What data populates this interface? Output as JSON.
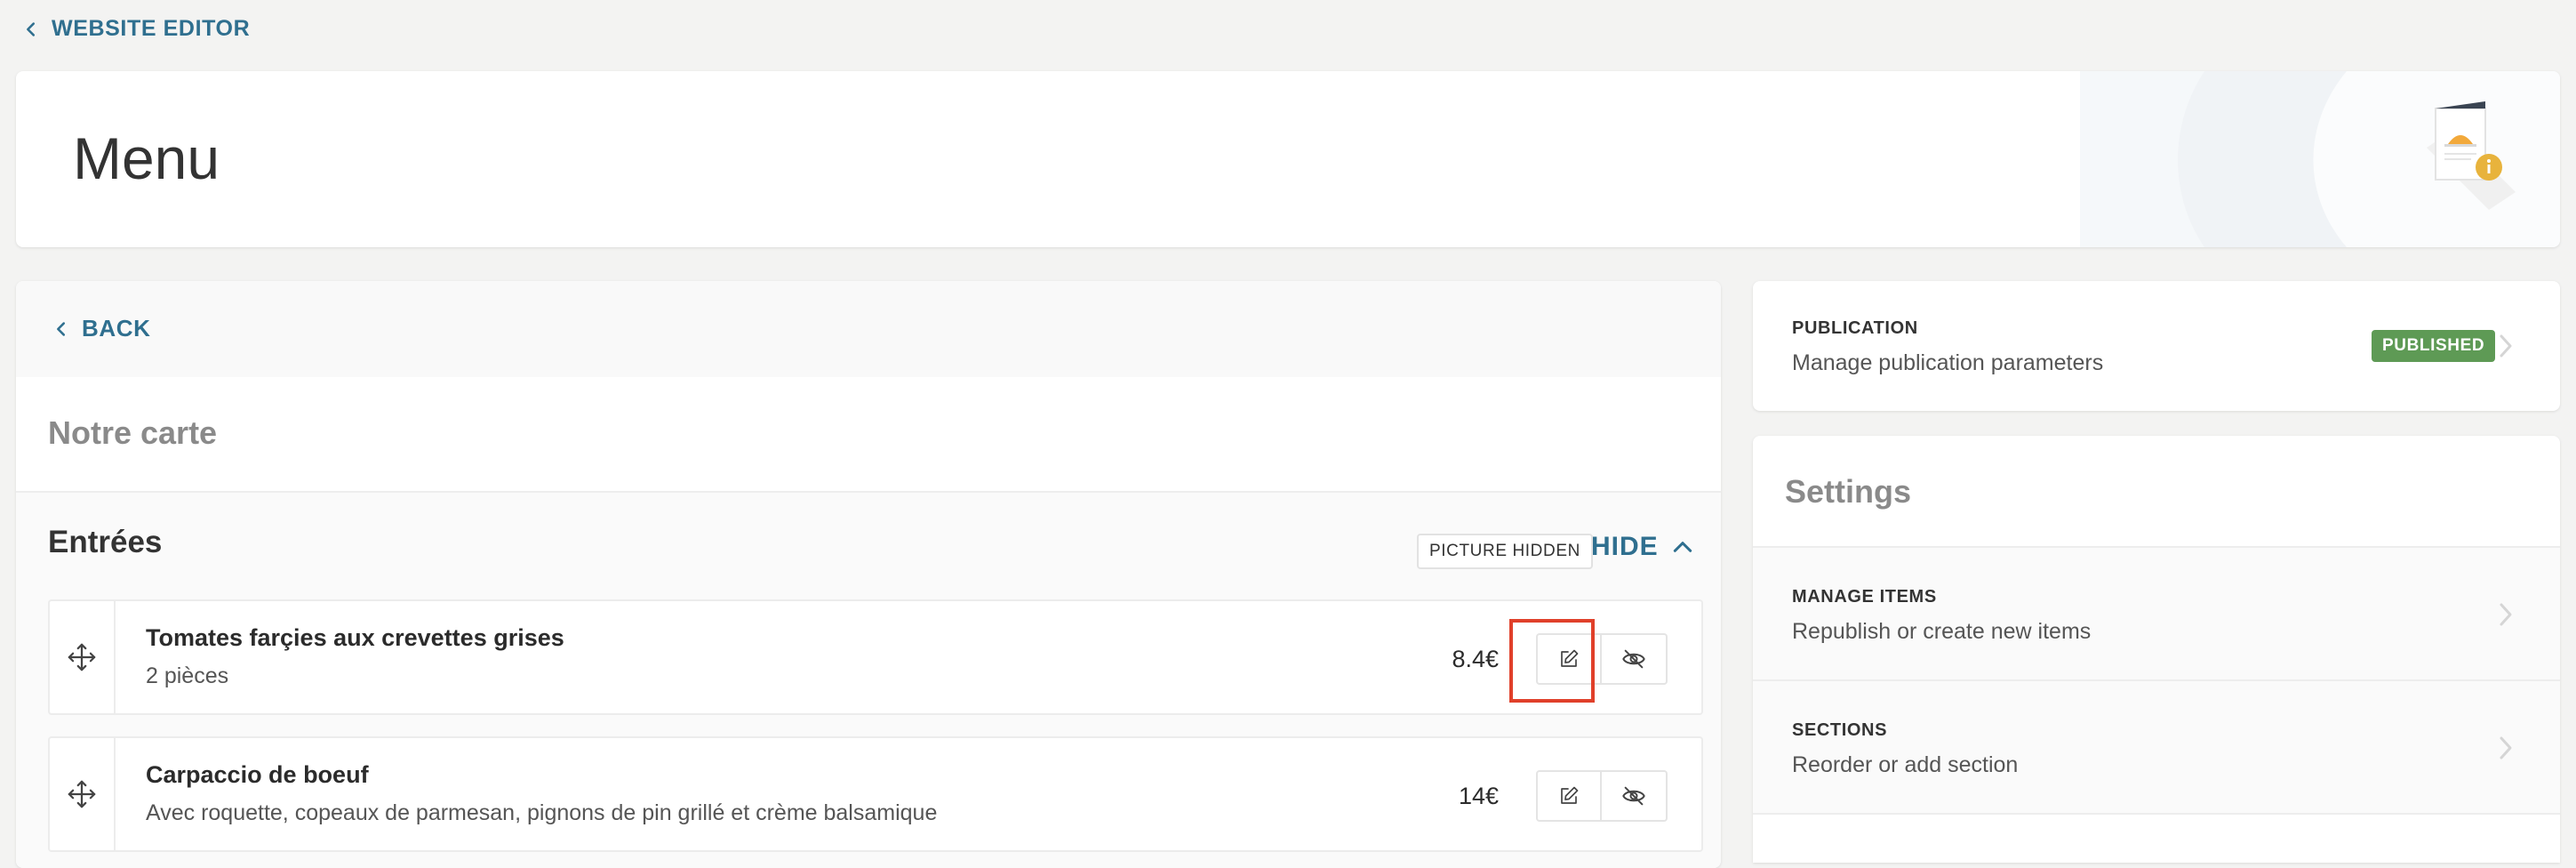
{
  "nav": {
    "back_label": "WEBSITE EDITOR"
  },
  "header": {
    "title": "Menu"
  },
  "main": {
    "back_label": "BACK",
    "menu_name": "Notre carte",
    "section": {
      "title": "Entrées",
      "picture_badge": "PICTURE HIDDEN",
      "hide_label": "HIDE",
      "items": [
        {
          "name": "Tomates farçies aux crevettes grises",
          "description": "2 pièces",
          "price": "8.4€"
        },
        {
          "name": "Carpaccio de boeuf",
          "description": "Avec roquette, copeaux de parmesan, pignons de pin grillé et crème balsamique",
          "price": "14€"
        }
      ]
    }
  },
  "publication": {
    "label": "PUBLICATION",
    "description": "Manage publication parameters",
    "status": "PUBLISHED"
  },
  "settings": {
    "title": "Settings",
    "rows": [
      {
        "label": "MANAGE ITEMS",
        "description": "Republish or create new items"
      },
      {
        "label": "SECTIONS",
        "description": "Reorder or add section"
      }
    ]
  },
  "colors": {
    "accent": "#2f6f8f",
    "published": "#5e9a55",
    "highlight": "#e0402a",
    "page_bg": "#f3f3f2"
  },
  "icons": [
    "chevron-left-icon",
    "move-icon",
    "edit-icon",
    "eye-off-icon",
    "chevron-up-icon",
    "chevron-right-icon",
    "menu-illustration-icon"
  ]
}
